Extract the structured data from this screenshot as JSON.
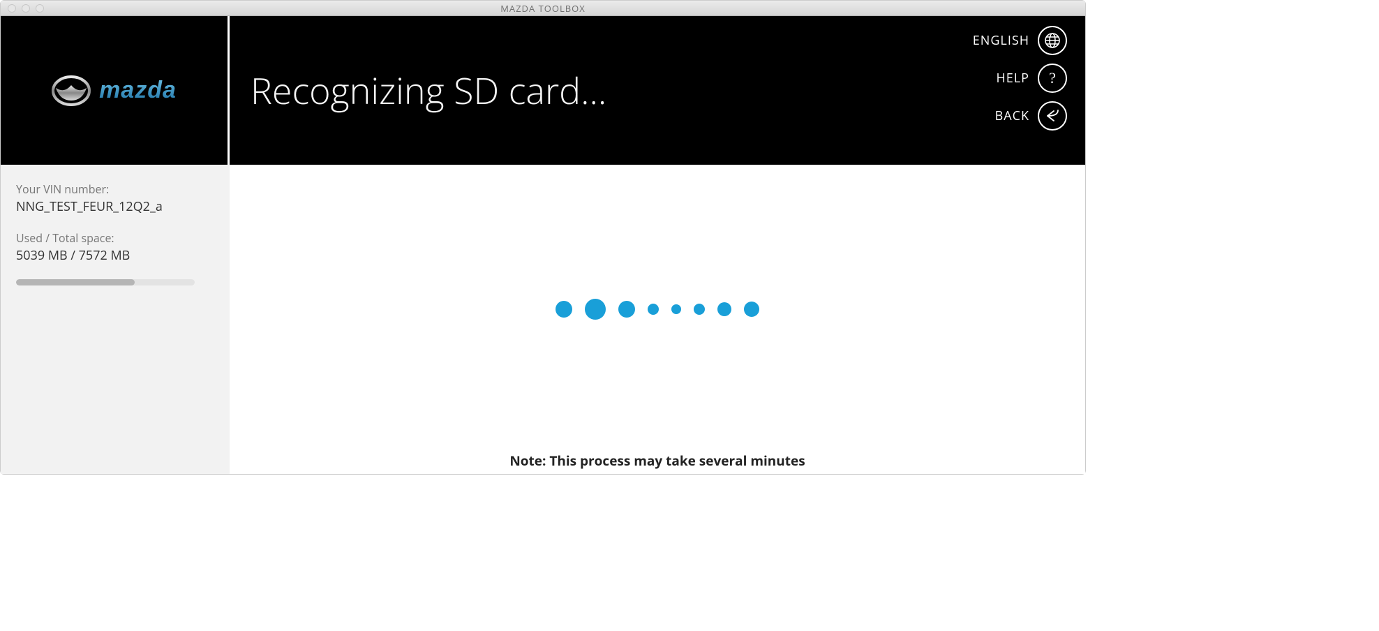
{
  "window": {
    "title": "MAZDA TOOLBOX"
  },
  "brand": {
    "name": "mazda"
  },
  "sidebar": {
    "vin_label": "Your VIN number:",
    "vin_value": "NNG_TEST_FEUR_12Q2_a",
    "space_label": "Used / Total space:",
    "space_value": "5039 MB / 7572 MB",
    "used_percent": 66.5
  },
  "header": {
    "title": "Recognizing SD card...",
    "buttons": {
      "language": "ENGLISH",
      "help": "HELP",
      "back": "BACK"
    }
  },
  "main": {
    "note": "Note: This process may take several minutes",
    "loader_color": "#199fd8",
    "dot_sizes": [
      24,
      30,
      24,
      16,
      14,
      16,
      20,
      22
    ]
  }
}
